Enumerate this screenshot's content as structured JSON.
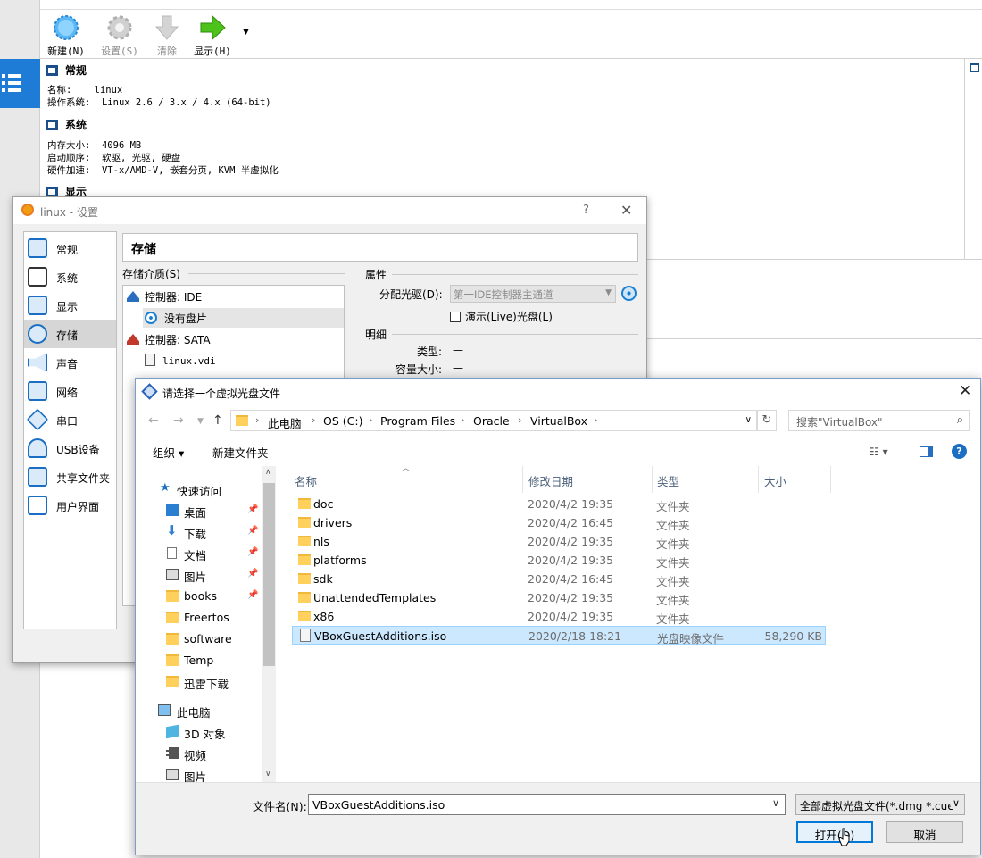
{
  "main": {
    "toolbar": {
      "new": "新建(N)",
      "settings": "设置(S)",
      "discard": "清除",
      "show": "显示(H)"
    },
    "sections": {
      "general": {
        "title": "常规",
        "name_label": "名称:",
        "name_value": "linux",
        "os_label": "操作系统:",
        "os_value": "Linux 2.6 / 3.x / 4.x (64-bit)"
      },
      "system": {
        "title": "系统",
        "mem_label": "内存大小:",
        "mem_value": "4096 MB",
        "boot_label": "启动顺序:",
        "boot_value": "软驱, 光驱, 硬盘",
        "accel_label": "硬件加速:",
        "accel_value": "VT-x/AMD-V, 嵌套分页, KVM 半虚拟化"
      },
      "display": {
        "title": "显示"
      }
    }
  },
  "settings_dialog": {
    "title": "linux - 设置",
    "help": "?",
    "close": "✕",
    "categories": [
      "常规",
      "系统",
      "显示",
      "存储",
      "声音",
      "网络",
      "串口",
      "USB设备",
      "共享文件夹",
      "用户界面"
    ],
    "selected_category": "存储",
    "panel_title": "存储",
    "storage_media_label": "存储介质(S)",
    "tree": {
      "ide_controller": "控制器: IDE",
      "ide_item": "没有盘片",
      "sata_controller": "控制器: SATA",
      "sata_item": "linux.vdi"
    },
    "attributes_label": "属性",
    "optical_drive_label": "分配光驱(D):",
    "optical_drive_value": "第一IDE控制器主通道",
    "live_cd_label": "演示(Live)光盘(L)",
    "info_label": "明细",
    "type_label": "类型:",
    "type_value": "—",
    "size_label": "容量大小:",
    "size_value": "—"
  },
  "file_dialog": {
    "title": "请选择一个虚拟光盘文件",
    "close": "✕",
    "breadcrumbs": [
      "此电脑",
      "OS (C:)",
      "Program Files",
      "Oracle",
      "VirtualBox"
    ],
    "search_placeholder": "搜索\"VirtualBox\"",
    "organize": "组织 ▾",
    "new_folder": "新建文件夹",
    "columns": {
      "name": "名称",
      "date": "修改日期",
      "type": "类型",
      "size": "大小"
    },
    "nav": {
      "quick_access": "快速访问",
      "items": [
        "桌面",
        "下载",
        "文档",
        "图片",
        "books",
        "Freertos",
        "software",
        "Temp",
        "迅雷下载"
      ],
      "this_pc": "此电脑",
      "pc_items": [
        "3D 对象",
        "视频",
        "图片"
      ]
    },
    "files": [
      {
        "name": "doc",
        "date": "2020/4/2 19:35",
        "type": "文件夹",
        "size": ""
      },
      {
        "name": "drivers",
        "date": "2020/4/2 16:45",
        "type": "文件夹",
        "size": ""
      },
      {
        "name": "nls",
        "date": "2020/4/2 19:35",
        "type": "文件夹",
        "size": ""
      },
      {
        "name": "platforms",
        "date": "2020/4/2 19:35",
        "type": "文件夹",
        "size": ""
      },
      {
        "name": "sdk",
        "date": "2020/4/2 16:45",
        "type": "文件夹",
        "size": ""
      },
      {
        "name": "UnattendedTemplates",
        "date": "2020/4/2 19:35",
        "type": "文件夹",
        "size": ""
      },
      {
        "name": "x86",
        "date": "2020/4/2 19:35",
        "type": "文件夹",
        "size": ""
      },
      {
        "name": "VBoxGuestAdditions.iso",
        "date": "2020/2/18 18:21",
        "type": "光盘映像文件",
        "size": "58,290 KB"
      }
    ],
    "filename_label": "文件名(N):",
    "filename_value": "VBoxGuestAdditions.iso",
    "filetype_value": "全部虚拟光盘文件(*.dmg *.cue",
    "open_button": "打开(O)",
    "cancel_button": "取消"
  },
  "colors": {
    "accent": "#1e7cd6",
    "selection": "#cce8ff",
    "folder": "#ffd15c"
  }
}
